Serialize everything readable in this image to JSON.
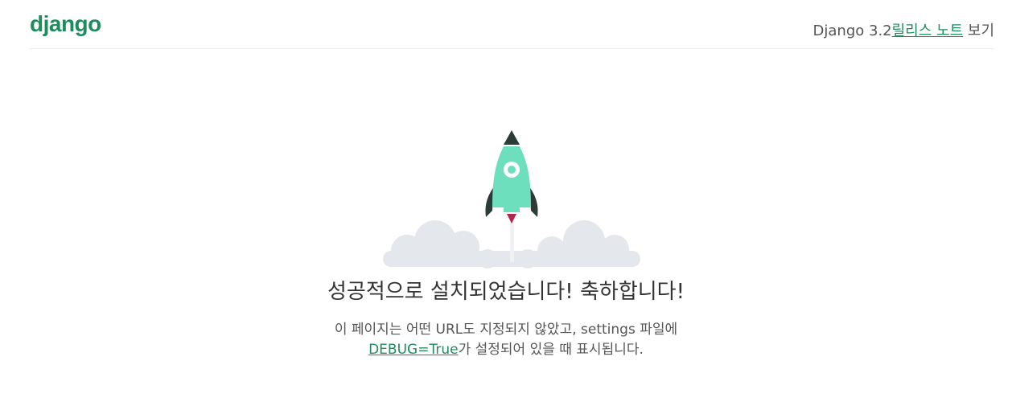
{
  "header": {
    "logo": "django",
    "release_prefix": "Django 3.2",
    "release_link": "릴리스 노트",
    "release_suffix": " 보기"
  },
  "main": {
    "title": "성공적으로 설치되었습니다! 축하합니다!",
    "msg_line1": "이 페이지는 어떤 URL도 지정되지 않았고, settings 파일에",
    "msg_link": "DEBUG=True",
    "msg_line2": "가 설정되어 있을 때 표시됩니다."
  },
  "colors": {
    "brand": "#1f8c5e",
    "rocket_body": "#6ddfbd",
    "rocket_dark": "#2b3b37",
    "flame": "#b2254d",
    "cloud": "#e4e7eb"
  }
}
